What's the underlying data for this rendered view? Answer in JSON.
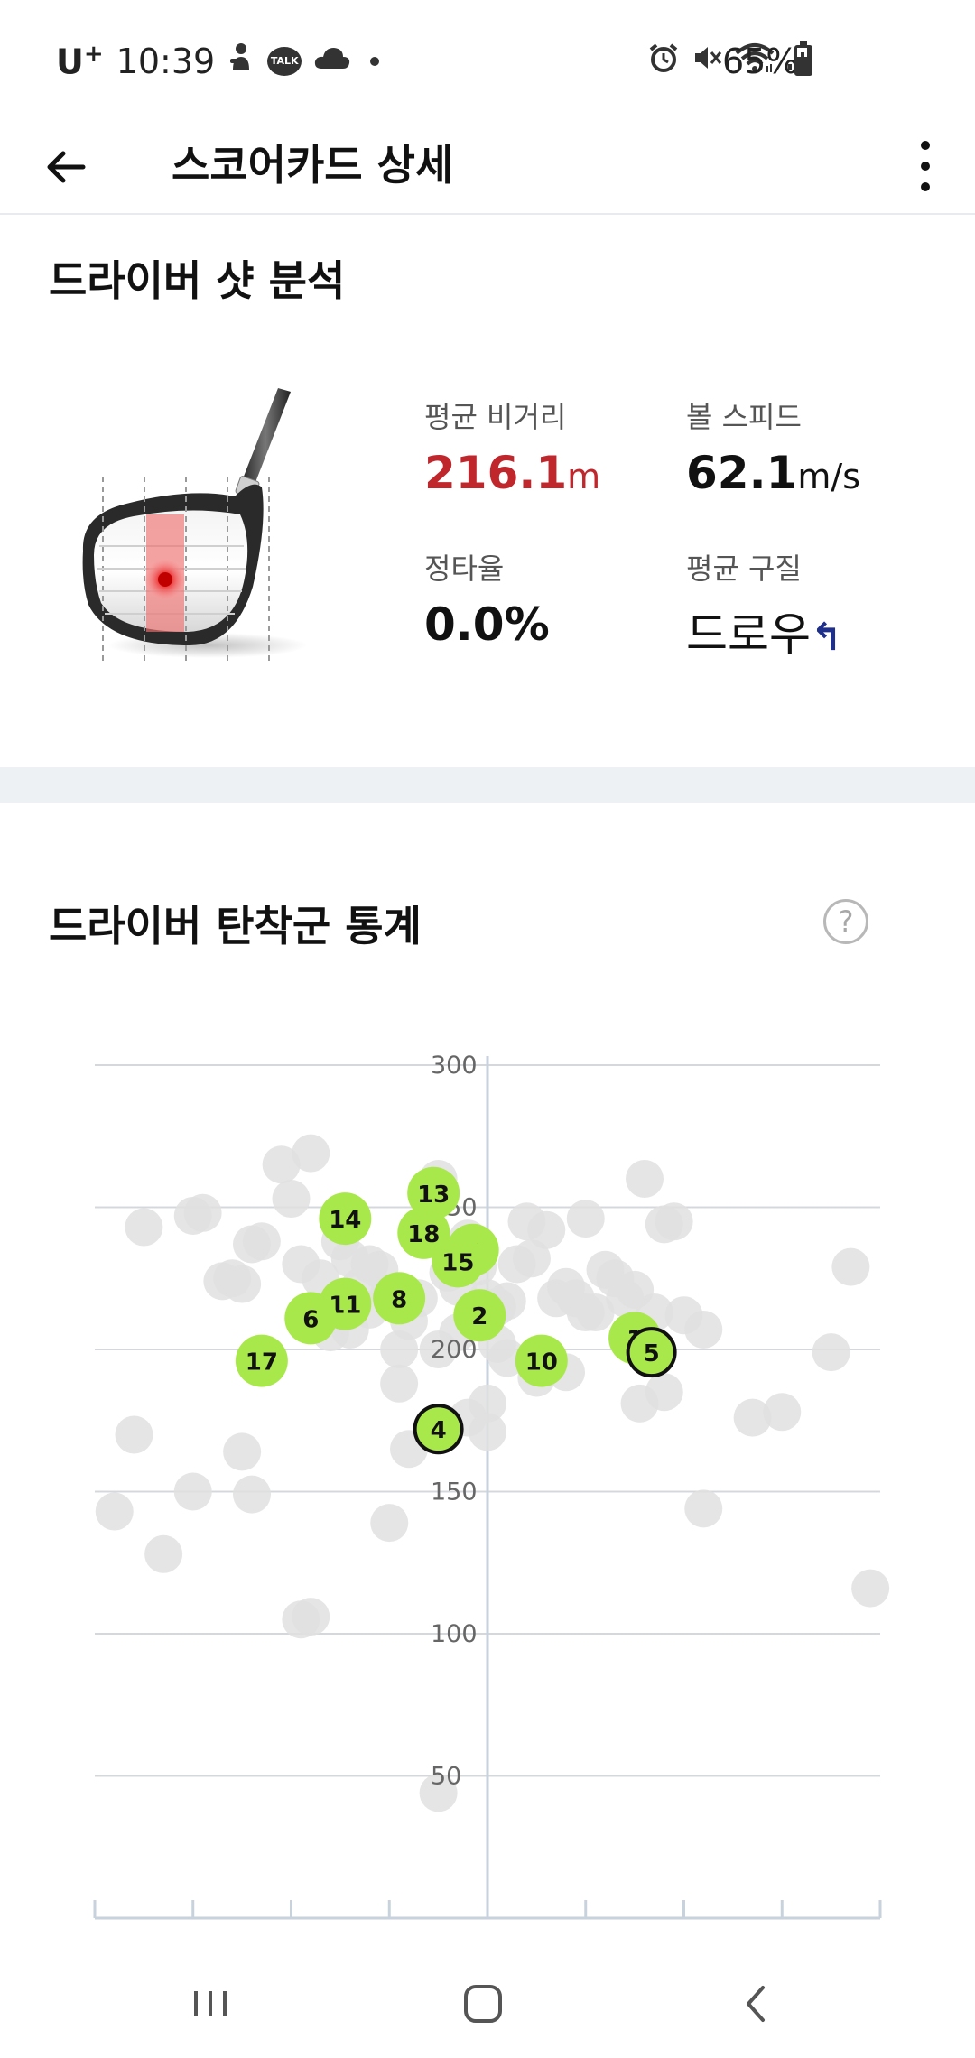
{
  "status": {
    "carrier": "U",
    "carrier_sup": "+",
    "time": "10:39",
    "battery": "65%",
    "battery_fraction": 0.65,
    "icons": [
      "child-icon",
      "talk-icon",
      "cloud-icon",
      "dot-icon",
      "alarm-icon",
      "mute-icon",
      "wifi-icon",
      "signal-icon",
      "battery-icon"
    ]
  },
  "header": {
    "title": "스코어카드 상세"
  },
  "driver_analysis": {
    "title": "드라이버 샷 분석",
    "avg_distance_label": "평균 비거리",
    "avg_distance_value": "216.1",
    "avg_distance_unit": "m",
    "ball_speed_label": "볼 스피드",
    "ball_speed_value": "62.1",
    "ball_speed_unit": "m/s",
    "accuracy_label": "정타율",
    "accuracy_value": "0.0%",
    "avg_shape_label": "평균 구질",
    "avg_shape_value": "드로우",
    "avg_shape_arrow": "↰"
  },
  "dispersion": {
    "title": "드라이버 탄착군 통계",
    "help": "?"
  },
  "chart_data": {
    "type": "scatter",
    "title": "",
    "xlabel": "",
    "ylabel": "",
    "ylim": [
      0,
      300
    ],
    "xlim": [
      -40,
      40
    ],
    "y_ticks": [
      "300",
      "250",
      "200",
      "150",
      "100",
      "50"
    ],
    "grid": true,
    "colors": {
      "history": "#e0e0e0",
      "current": "#a9e84a",
      "current_outline": "#111111",
      "axis": "#c8d2dc"
    },
    "current_round": [
      {
        "label": "13",
        "x": -5.5,
        "y": 255,
        "outlined": false
      },
      {
        "label": "14",
        "x": -14.5,
        "y": 246,
        "outlined": false
      },
      {
        "label": "18",
        "x": -6.5,
        "y": 241,
        "outlined": false
      },
      {
        "label": "9",
        "x": -1.5,
        "y": 235,
        "outlined": false
      },
      {
        "label": "15",
        "x": -3,
        "y": 231,
        "outlined": false
      },
      {
        "label": "8",
        "x": -9,
        "y": 218,
        "outlined": false
      },
      {
        "label": "11",
        "x": -14.5,
        "y": 216,
        "outlined": false
      },
      {
        "label": "6",
        "x": -18,
        "y": 211,
        "outlined": false
      },
      {
        "label": "2",
        "x": -0.8,
        "y": 212,
        "outlined": false
      },
      {
        "label": "1",
        "x": 15,
        "y": 204,
        "outlined": false
      },
      {
        "label": "5",
        "x": 16.7,
        "y": 199,
        "outlined": true
      },
      {
        "label": "10",
        "x": 5.5,
        "y": 196,
        "outlined": false
      },
      {
        "label": "17",
        "x": -23,
        "y": 196,
        "outlined": false
      },
      {
        "label": "4",
        "x": -5,
        "y": 172,
        "outlined": true
      }
    ],
    "history": [
      [
        -35,
        243
      ],
      [
        -30,
        247
      ],
      [
        -29,
        248
      ],
      [
        -27,
        224
      ],
      [
        -26,
        225
      ],
      [
        -25,
        223
      ],
      [
        -24,
        237
      ],
      [
        -23,
        238
      ],
      [
        -21,
        265
      ],
      [
        -20,
        253
      ],
      [
        -18,
        269
      ],
      [
        -19,
        230
      ],
      [
        -17,
        225
      ],
      [
        -15,
        238
      ],
      [
        -14,
        232
      ],
      [
        -13,
        222
      ],
      [
        -12,
        230
      ],
      [
        -11,
        228
      ],
      [
        -10,
        220
      ],
      [
        -16,
        206
      ],
      [
        -14,
        207
      ],
      [
        -12,
        214
      ],
      [
        -8,
        210
      ],
      [
        -7,
        218
      ],
      [
        -4,
        227
      ],
      [
        -3,
        222
      ],
      [
        -6,
        241
      ],
      [
        -5,
        260
      ],
      [
        -2,
        239
      ],
      [
        -1,
        229
      ],
      [
        0,
        218
      ],
      [
        1,
        215
      ],
      [
        2,
        217
      ],
      [
        3,
        230
      ],
      [
        4,
        245
      ],
      [
        4.5,
        232
      ],
      [
        6,
        242
      ],
      [
        7,
        218
      ],
      [
        8,
        222
      ],
      [
        9,
        218
      ],
      [
        10,
        213
      ],
      [
        11,
        213
      ],
      [
        12,
        228
      ],
      [
        13,
        225
      ],
      [
        14,
        218
      ],
      [
        15,
        221
      ],
      [
        17,
        213
      ],
      [
        18,
        244
      ],
      [
        19,
        245
      ],
      [
        20,
        212
      ],
      [
        22,
        207
      ],
      [
        10,
        246
      ],
      [
        16,
        260
      ],
      [
        15.5,
        181
      ],
      [
        -1,
        210
      ],
      [
        2,
        197
      ],
      [
        1,
        202
      ],
      [
        -5,
        200
      ],
      [
        -9,
        200
      ],
      [
        -9,
        188
      ],
      [
        -8,
        165
      ],
      [
        -3,
        206
      ],
      [
        -2,
        176
      ],
      [
        0,
        181
      ],
      [
        0,
        171
      ],
      [
        5,
        190
      ],
      [
        8,
        192
      ],
      [
        18,
        185
      ],
      [
        27,
        176
      ],
      [
        30,
        178
      ],
      [
        35,
        199
      ],
      [
        37,
        229
      ],
      [
        39,
        116
      ],
      [
        22,
        144
      ],
      [
        -36,
        170
      ],
      [
        -30,
        150
      ],
      [
        -25,
        164
      ],
      [
        -24,
        149
      ],
      [
        -38,
        143
      ],
      [
        -33,
        128
      ],
      [
        -19,
        105
      ],
      [
        -18,
        106
      ],
      [
        -10,
        139
      ],
      [
        -5,
        44
      ]
    ]
  },
  "nav": {
    "recents": "recents-icon",
    "home": "home-icon",
    "back": "back-nav-icon"
  }
}
